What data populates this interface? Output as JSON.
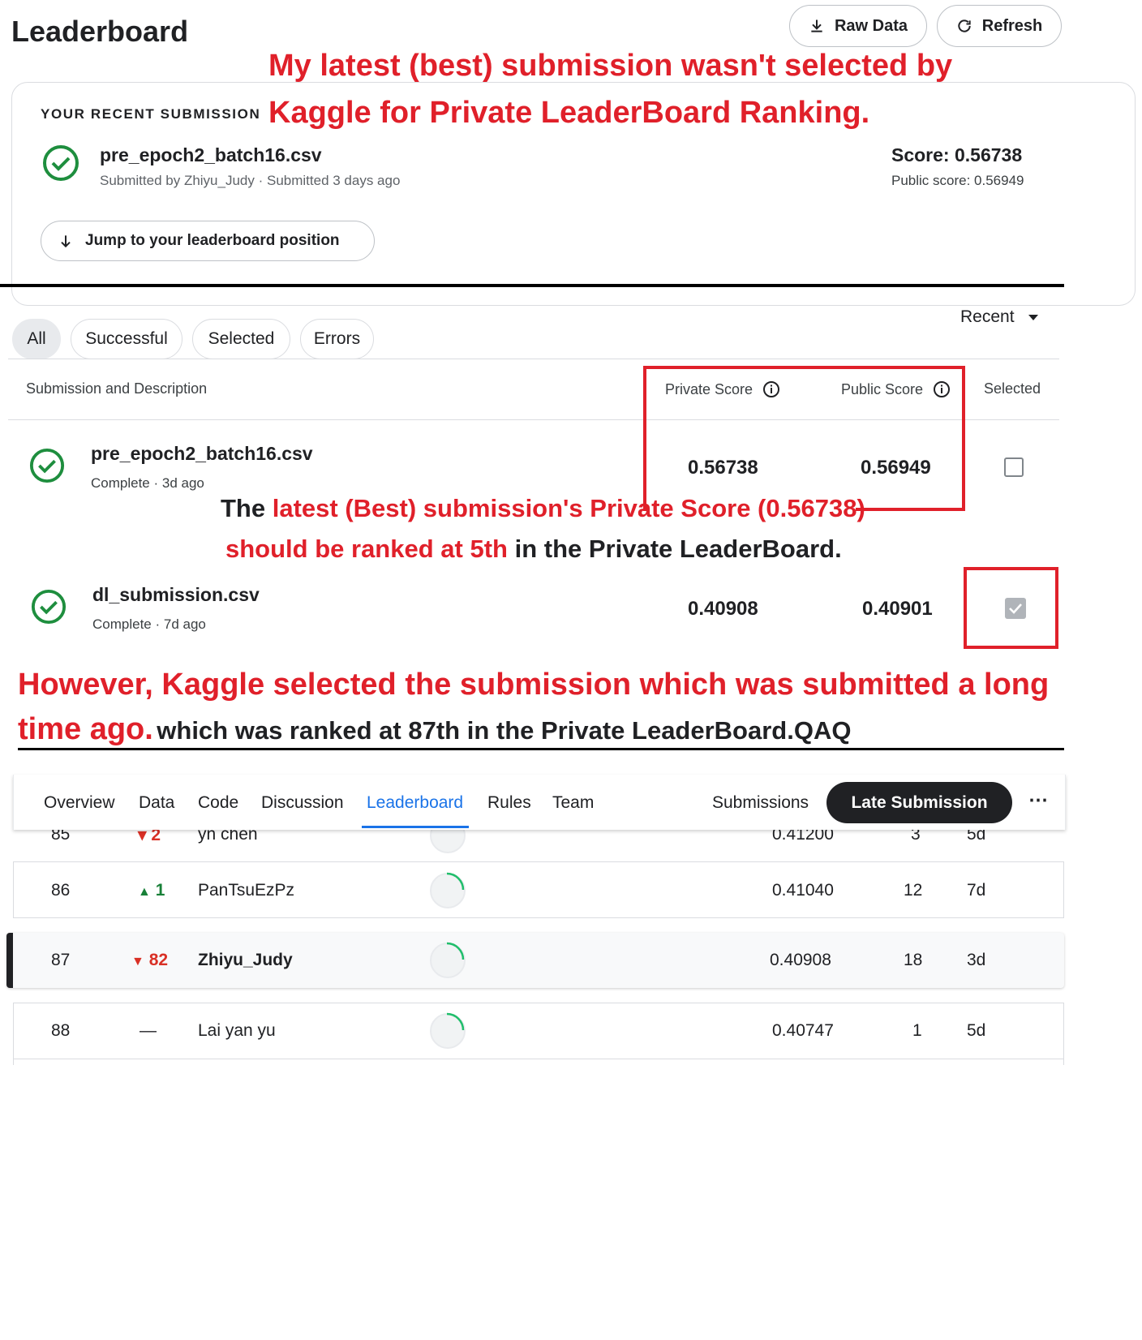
{
  "header": {
    "title": "Leaderboard",
    "raw_data_label": "Raw Data",
    "refresh_label": "Refresh"
  },
  "annotations": {
    "top_line1": "My latest (best) submission wasn't selected by",
    "top_line2": "Kaggle for Private LeaderBoard Ranking.",
    "mid_line1_black": "The",
    "mid_line1_red": "latest (Best) submission's Private Score (0.56738)",
    "mid_line2_red": "should be ranked at 5th",
    "mid_line2_black": "in the Private LeaderBoard.",
    "bottom_line1_red": "However, Kaggle selected the submission which was submitted a long",
    "bottom_line2_red": "time ago.",
    "bottom_line2_black": "which was ranked at 87th in the Private LeaderBoard.QAQ"
  },
  "recent": {
    "overline": "YOUR RECENT SUBMISSION",
    "filename": "pre_epoch2_batch16.csv",
    "submitted": "Submitted by Zhiyu_Judy · Submitted 3 days ago",
    "score": "Score: 0.56738",
    "public_score": "Public score: 0.56949",
    "jump_label": "Jump to your leaderboard position"
  },
  "filters": {
    "chips": [
      "All",
      "Successful",
      "Selected",
      "Errors"
    ],
    "active": "All",
    "sort": "Recent"
  },
  "table": {
    "headers": {
      "submission": "Submission and Description",
      "private": "Private Score",
      "public": "Public Score",
      "selected": "Selected"
    },
    "rows": [
      {
        "name": "pre_epoch2_batch16.csv",
        "meta": "Complete · 3d ago",
        "private": "0.56738",
        "public": "0.56949",
        "selected": false
      },
      {
        "name": "dl_submission.csv",
        "meta": "Complete · 7d ago",
        "private": "0.40908",
        "public": "0.40901",
        "selected": true
      }
    ]
  },
  "nav": {
    "tabs": [
      "Overview",
      "Data",
      "Code",
      "Discussion",
      "Leaderboard",
      "Rules",
      "Team"
    ],
    "active": "Leaderboard",
    "submissions": "Submissions",
    "late_submission": "Late Submission",
    "more": "⋯"
  },
  "leaderboard": {
    "partial_row": {
      "rank": "85",
      "change": "2",
      "name": "yn chen",
      "score": "0.41200",
      "entries": "3",
      "last": "5d"
    },
    "rows": [
      {
        "rank": "86",
        "change_dir": "up",
        "change": "1",
        "name": "PanTsuEzPz",
        "score": "0.41040",
        "entries": "12",
        "last": "7d",
        "highlight": false
      },
      {
        "rank": "87",
        "change_dir": "down",
        "change": "82",
        "name": "Zhiyu_Judy",
        "score": "0.40908",
        "entries": "18",
        "last": "3d",
        "highlight": true
      },
      {
        "rank": "88",
        "change_dir": "none",
        "change": "—",
        "name": "Lai yan yu",
        "score": "0.40747",
        "entries": "1",
        "last": "5d",
        "highlight": false
      }
    ]
  },
  "colors": {
    "annotation_red": "#e0202a",
    "success_green": "#1e8e3e",
    "link_blue": "#1a73e8",
    "rank_down_red": "#d93025",
    "rank_up_green": "#188038"
  }
}
